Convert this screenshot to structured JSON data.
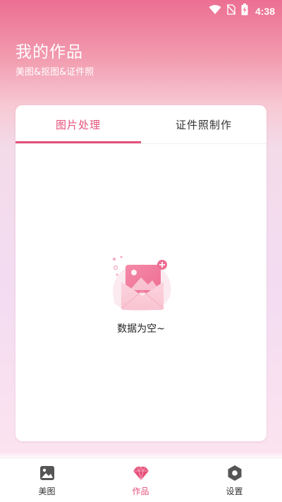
{
  "status_bar": {
    "time": "4:38",
    "icons": [
      "wifi-icon",
      "no-sim-icon",
      "battery-charging-icon"
    ]
  },
  "header": {
    "title": "我的作品",
    "subtitle": "美图&抠图&证件照"
  },
  "tabs": [
    {
      "label": "图片处理",
      "active": true
    },
    {
      "label": "证件照制作",
      "active": false
    }
  ],
  "empty_state": {
    "icon": "empty-envelope-illustration",
    "text": "数据为空~"
  },
  "bottom_nav": [
    {
      "label": "美图",
      "icon": "image-icon",
      "active": false
    },
    {
      "label": "作品",
      "icon": "gem-icon",
      "active": true
    },
    {
      "label": "设置",
      "icon": "settings-hexagon-icon",
      "active": false
    }
  ],
  "colors": {
    "accent": "#e5507a",
    "header_pink": "#ec6f92",
    "text_dark": "#333333",
    "icon_gray": "#555555"
  }
}
